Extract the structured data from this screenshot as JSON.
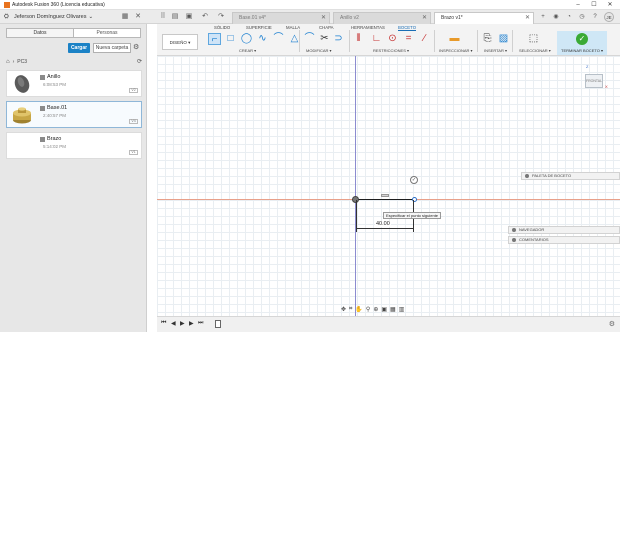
{
  "window": {
    "title": "Autodesk Fusion 360 (Licencia educativa)",
    "minimize": "–",
    "maximize": "☐",
    "close": "✕"
  },
  "topbar": {
    "user_name": "Jeferson Domínguez Olivares",
    "tabs": [
      {
        "label": "Base.01 v4*",
        "active": false
      },
      {
        "label": "Anillo v2",
        "active": false
      },
      {
        "label": "Brazo v1*",
        "active": true
      }
    ],
    "avatar_initials": "JE"
  },
  "data_panel": {
    "tabs": [
      "Datos",
      "Personas"
    ],
    "upload_label": "Cargar",
    "new_folder_label": "Nueva carpeta",
    "breadcrumb": "PC3",
    "items": [
      {
        "name": "Anillo",
        "time": "6:08:53 PM",
        "version": "V2"
      },
      {
        "name": "Base.01",
        "time": "2:40:57 PM",
        "version": "V4"
      },
      {
        "name": "Brazo",
        "time": "5:14:02 PM",
        "version": "V1"
      }
    ]
  },
  "toolbar": {
    "menu_tabs": [
      "SÓLIDO",
      "SUPERFICIE",
      "MALLA",
      "CHAPA",
      "HERRAMIENTAS",
      "BOCETO"
    ],
    "active_tab": "BOCETO",
    "design_label": "DISEÑO ▾",
    "groups": {
      "create": "CREAR ▾",
      "modify": "MODIFICAR ▾",
      "constraints": "RESTRICCIONES ▾",
      "inspect": "INSPECCIONAR ▾",
      "insert": "INSERTAR ▾",
      "select": "SELECCIONAR ▾",
      "finish": "TERMINAR BOCETO ▾"
    }
  },
  "canvas": {
    "dimension_value": "40.00",
    "tooltip": "Especificar el punto siguiente",
    "sketch_palette_label": "PALETA DE BOCETO",
    "navigator_label": "NAVEGADOR",
    "comments_label": "COMENTARIOS",
    "viewcube_face": "FRONTAL",
    "viewcube_z": "Z",
    "viewcube_x": "X"
  },
  "colors": {
    "accent": "#1b82c6",
    "finish_green": "#3aaa35",
    "sketch_line": "#1e1e1e"
  }
}
